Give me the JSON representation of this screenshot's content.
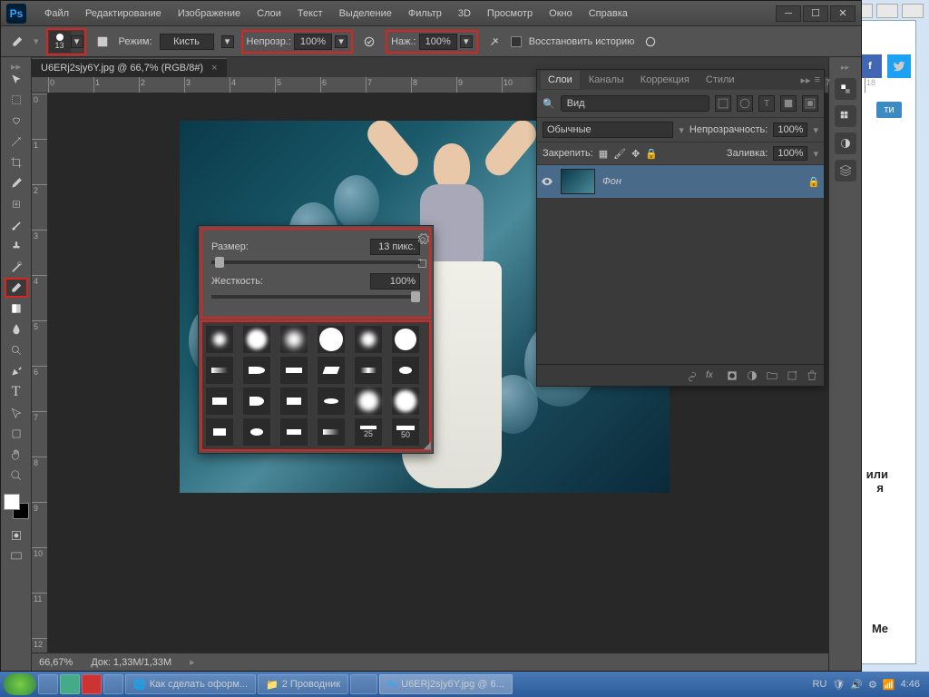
{
  "app": {
    "logo": "Ps"
  },
  "menu": [
    "Файл",
    "Редактирование",
    "Изображение",
    "Слои",
    "Текст",
    "Выделение",
    "Фильтр",
    "3D",
    "Просмотр",
    "Окно",
    "Справка"
  ],
  "options": {
    "brush_size": "13",
    "mode_label": "Режим:",
    "mode_value": "Кисть",
    "opacity_label": "Непрозр.:",
    "opacity_value": "100%",
    "flow_label": "Наж.:",
    "flow_value": "100%",
    "restore_label": "Восстановить историю"
  },
  "document": {
    "tab": "U6ERj2sjy6Y.jpg @ 66,7% (RGB/8#)"
  },
  "brush_popup": {
    "size_label": "Размер:",
    "size_value": "13 пикс.",
    "hardness_label": "Жесткость:",
    "hardness_value": "100%",
    "brush_labels": [
      "",
      "",
      "",
      "",
      "",
      "",
      "",
      "",
      "",
      "",
      "",
      "",
      "",
      "",
      "",
      "",
      "",
      "",
      "",
      "",
      "",
      "",
      "25",
      "50"
    ]
  },
  "layers": {
    "tabs": [
      "Слои",
      "Каналы",
      "Коррекция",
      "Стили"
    ],
    "search_placeholder": "Вид",
    "blend_mode": "Обычные",
    "opacity_label": "Непрозрачность:",
    "opacity_value": "100%",
    "lock_label": "Закрепить:",
    "fill_label": "Заливка:",
    "fill_value": "100%",
    "layer_name": "Фон"
  },
  "status": {
    "zoom": "66,67%",
    "doc": "Док: 1,33M/1,33M"
  },
  "taskbar": {
    "items": [
      "",
      "",
      "",
      "",
      "Как сделать оформ...",
      "2 Проводник",
      "",
      "U6ERj2sjy6Y.jpg @ 6..."
    ],
    "lang": "RU",
    "time": "4:46"
  },
  "bg_text": {
    "me": "Me",
    "suffix1": ": или",
    "suffix2": "я",
    "btn": "ти"
  }
}
